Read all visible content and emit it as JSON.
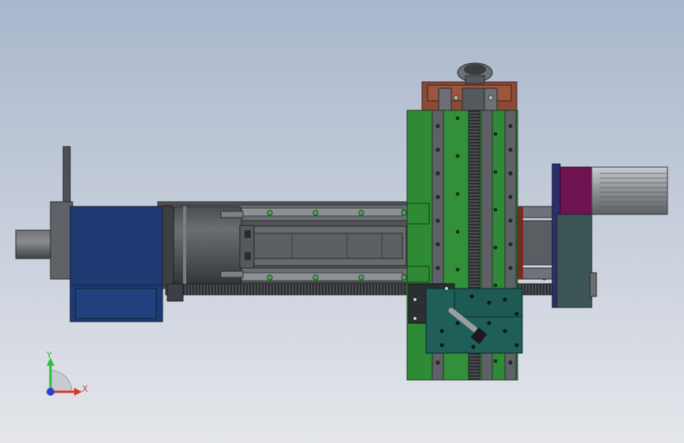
{
  "triad": {
    "y_label": "Y",
    "x_label": "X",
    "colors": {
      "y_axis": "#2bbf3a",
      "x_axis": "#d63a2a",
      "z_axis": "#2d3fd0"
    }
  },
  "colors": {
    "background_top": "#a9b6cc",
    "background_bottom": "#e4e6ea",
    "motor_blue": "#1d3a73",
    "rail_green": "#2f8a35",
    "frame_gray": "#555a5e",
    "bracket_brown": "#8a4a35",
    "carriage_teal": "#1f5f58",
    "motor_magenta": "#6f1250",
    "housing_slate": "#3b5655"
  }
}
